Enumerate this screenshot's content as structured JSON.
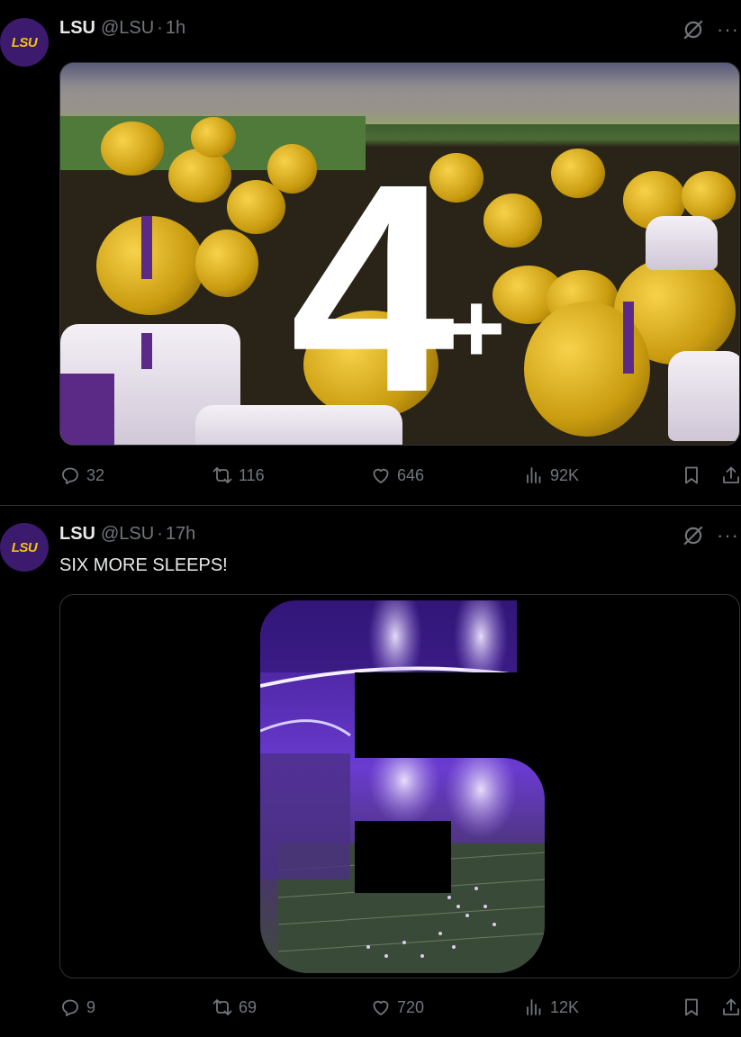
{
  "tweets": [
    {
      "avatar_text": "LSU",
      "name": "LSU",
      "handle": "@LSU",
      "separator": "·",
      "time": "1h",
      "text": "",
      "image_overlay": {
        "number": "4",
        "suffix": "+"
      },
      "stats": {
        "replies": "32",
        "reposts": "116",
        "likes": "646",
        "views": "92K"
      }
    },
    {
      "avatar_text": "LSU",
      "name": "LSU",
      "handle": "@LSU",
      "separator": "·",
      "time": "17h",
      "text": "SIX MORE SLEEPS!",
      "stats": {
        "replies": "9",
        "reposts": "69",
        "likes": "720",
        "views": "12K"
      }
    }
  ],
  "icons": {
    "reply": "reply-icon",
    "repost": "repost-icon",
    "like": "heart-icon",
    "views": "views-icon",
    "bookmark": "bookmark-icon",
    "share": "share-icon",
    "grok": "grok-icon",
    "more": "more-icon"
  },
  "colors": {
    "background": "#000000",
    "text": "#e7e9ea",
    "muted": "#71767b",
    "lsu_purple": "#3c1a6e",
    "lsu_gold": "#f5c10d"
  }
}
